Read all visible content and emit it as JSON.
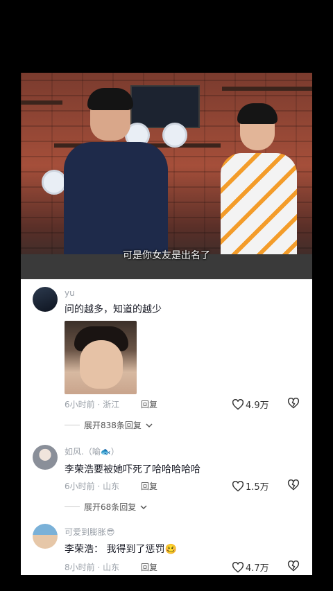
{
  "video": {
    "subtitle": "可是你女友是出名了"
  },
  "comments": [
    {
      "username": "yu",
      "text": "问的越多，知道的越少",
      "has_image": true,
      "time": "6小时前",
      "location": "浙江",
      "reply_label": "回复",
      "likes": "4.9万",
      "expand_label": "展开838条回复"
    },
    {
      "username": "如风.（喻🐟）",
      "text": "李荣浩要被她吓死了哈哈哈哈哈",
      "time": "6小时前",
      "location": "山东",
      "reply_label": "回复",
      "likes": "1.5万",
      "expand_label": "展开68条回复"
    },
    {
      "username": "可爱到膨胀😎",
      "text": "李荣浩：  我得到了惩罚🥴",
      "time": "8小时前",
      "location": "山东",
      "reply_label": "回复",
      "likes": "4.7万"
    }
  ],
  "icons": {
    "like": "heart-outline-icon",
    "dislike": "broken-heart-icon",
    "expand": "chevron-down-icon"
  },
  "colors": {
    "meta_gray": "#9aa0a8",
    "text_dark": "#161823"
  }
}
